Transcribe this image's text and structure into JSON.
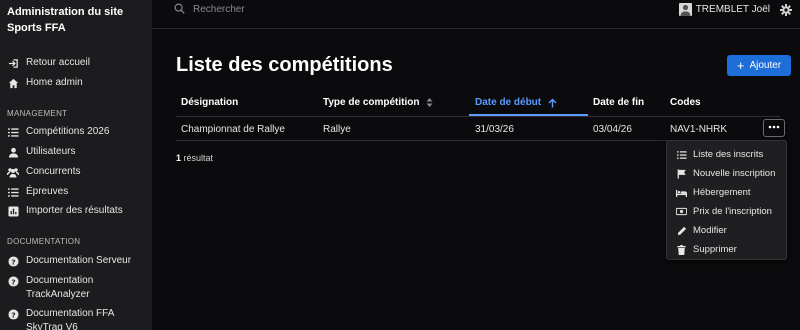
{
  "sidebar": {
    "site_title": "Administration du site Sports FFA",
    "top_items": [
      {
        "label": "Retour accueil",
        "icon": "sign-in-icon"
      },
      {
        "label": "Home admin",
        "icon": "home-icon"
      }
    ],
    "management_heading": "MANAGEMENT",
    "management_items": [
      {
        "label": "Compétitions 2026",
        "icon": "list-icon"
      },
      {
        "label": "Utilisateurs",
        "icon": "user-icon"
      },
      {
        "label": "Concurrents",
        "icon": "users-icon"
      },
      {
        "label": "Épreuves",
        "icon": "list-icon"
      },
      {
        "label": "Importer des résultats",
        "icon": "import-icon"
      }
    ],
    "documentation_heading": "DOCUMENTATION",
    "documentation_items": [
      {
        "label": "Documentation Serveur",
        "icon": "help-circle-icon"
      },
      {
        "label": "Documentation TrackAnalyzer",
        "icon": "help-circle-icon"
      },
      {
        "label": "Documentation FFA SkyTraq V6",
        "icon": "help-circle-icon"
      }
    ]
  },
  "topbar": {
    "search_placeholder": "Rechercher",
    "user_name": "TREMBLET Joël"
  },
  "main": {
    "title": "Liste des compétitions",
    "add_button_label": "Ajouter",
    "columns": [
      "Désignation",
      "Type de compétition",
      "Date de début",
      "Date de fin",
      "Codes"
    ],
    "sorted_column": "Date de début",
    "rows": [
      {
        "designation": "Championnat de Rallye",
        "type": "Rallye",
        "date_debut": "31/03/26",
        "date_fin": "03/04/26",
        "codes": "NAV1-NHRK"
      }
    ],
    "result_count": "1",
    "result_label": " résultat"
  },
  "row_menu": {
    "items": [
      {
        "label": "Liste des inscrits",
        "icon": "list-icon"
      },
      {
        "label": "Nouvelle inscription",
        "icon": "flag-icon"
      },
      {
        "label": "Hébergement",
        "icon": "bed-icon"
      },
      {
        "label": "Prix de l'inscription",
        "icon": "money-icon"
      },
      {
        "label": "Modifier",
        "icon": "pencil-icon"
      },
      {
        "label": "Supprimer",
        "icon": "trash-icon"
      }
    ]
  },
  "colors": {
    "accent": "#1c6ed9",
    "sort_active": "#5a9cff",
    "sidebar_bg": "#1c1c1e",
    "page_bg": "#0b0b0d"
  }
}
